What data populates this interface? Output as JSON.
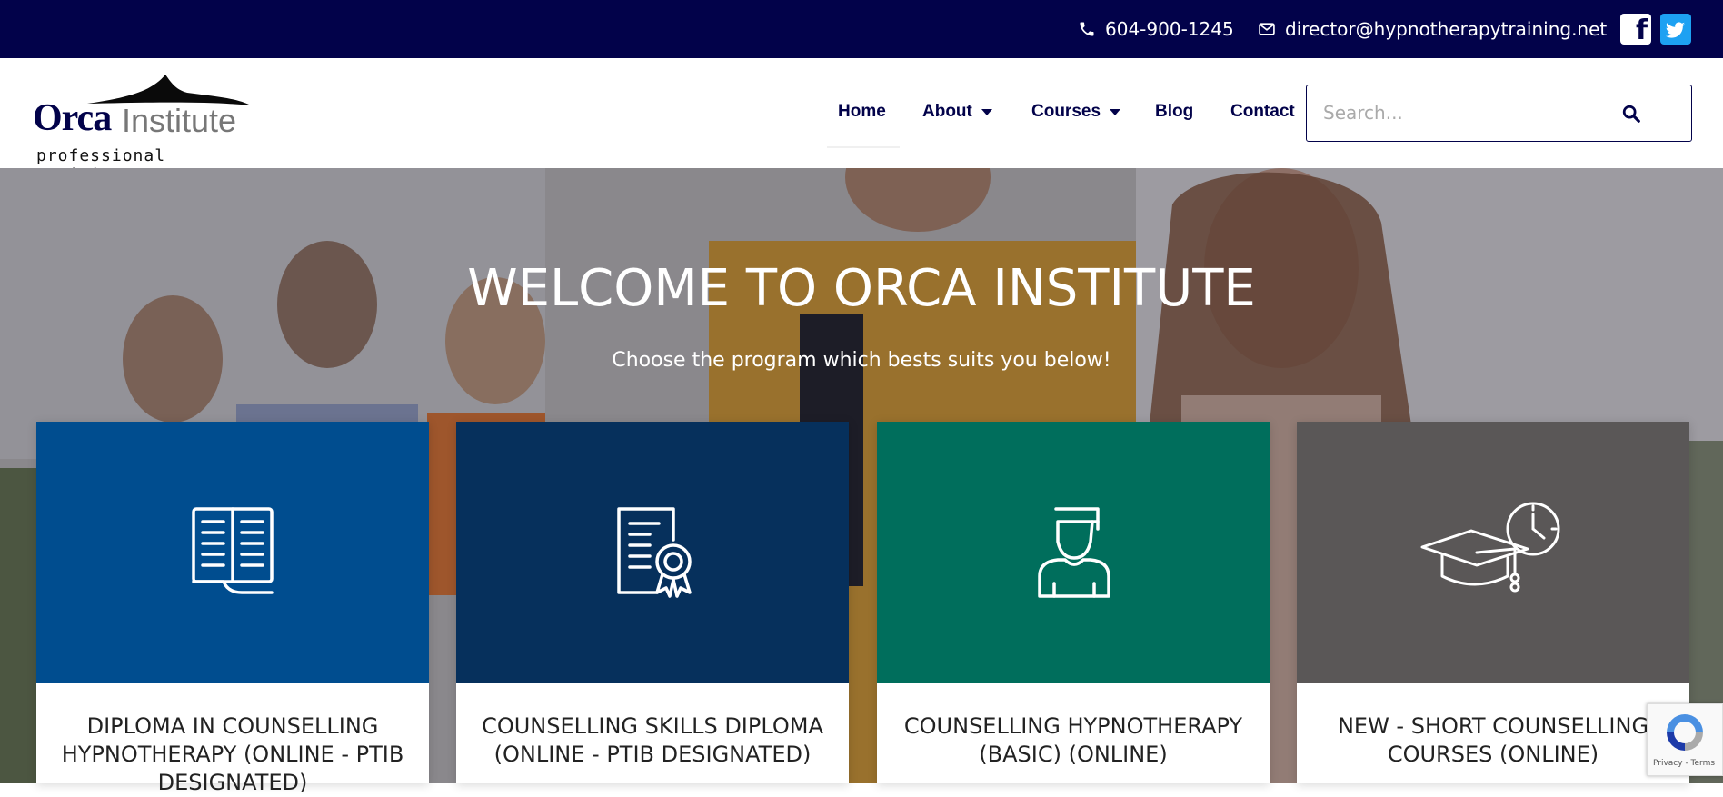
{
  "topbar": {
    "phone": "604-900-1245",
    "email": "director@hypnotherapytraining.net",
    "social": [
      "facebook-icon",
      "twitter-icon"
    ]
  },
  "header": {
    "logo": {
      "line1_bold": "Orca",
      "line1_light": "Institute",
      "line2": "professional training"
    },
    "nav": [
      {
        "label": "Home"
      },
      {
        "label": "About"
      },
      {
        "label": "Courses"
      },
      {
        "label": "Blog"
      },
      {
        "label": "Contact"
      }
    ],
    "search": {
      "placeholder": "Search..."
    }
  },
  "hero": {
    "title": "WELCOME TO ORCA INSTITUTE",
    "subtitle": "Choose the program which bests suits you below!"
  },
  "cards": [
    {
      "title": "DIPLOMA IN COUNSELLING HYPNOTHERAPY (ONLINE - PTIB DESIGNATED)",
      "color": "#004d8f",
      "icon": "open-book-icon"
    },
    {
      "title": "COUNSELLING SKILLS DIPLOMA (ONLINE - PTIB DESIGNATED)",
      "color": "#06305c",
      "icon": "certificate-icon"
    },
    {
      "title": "COUNSELLING HYPNOTHERAPY (BASIC) (ONLINE)",
      "color": "#006e5c",
      "icon": "graduate-icon"
    },
    {
      "title": "NEW - SHORT COUNSELLING COURSES (ONLINE)",
      "color": "#5a5757",
      "icon": "graduation-cap-clock-icon"
    }
  ],
  "recaptcha": {
    "footer": "Privacy - Terms"
  },
  "colors": {
    "topbar": "#02024a",
    "nav": "#02024a"
  }
}
